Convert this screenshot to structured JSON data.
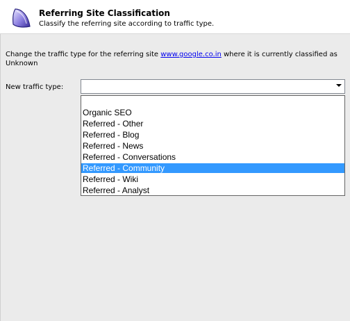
{
  "header": {
    "title": "Referring Site Classification",
    "subtitle": "Classify the referring site according to traffic type."
  },
  "description": {
    "prefix": "Change the traffic type for the referring site ",
    "link": "www.google.co.in",
    "suffix": " where it is currently classified as Unknown"
  },
  "traffic_type": {
    "label": "New traffic type:",
    "value": "",
    "options": [
      "",
      "Organic SEO",
      "Referred - Other",
      "Referred - Blog",
      "Referred - News",
      "Referred - Conversations",
      "Referred - Community",
      "Referred - Wiki",
      "Referred - Analyst"
    ],
    "highlighted": "Referred - Community"
  },
  "icons": {
    "header": "shield-icon",
    "dropdown": "chevron-down-icon"
  },
  "colors": {
    "selection": "#3399ff",
    "link": "#0000ee"
  }
}
